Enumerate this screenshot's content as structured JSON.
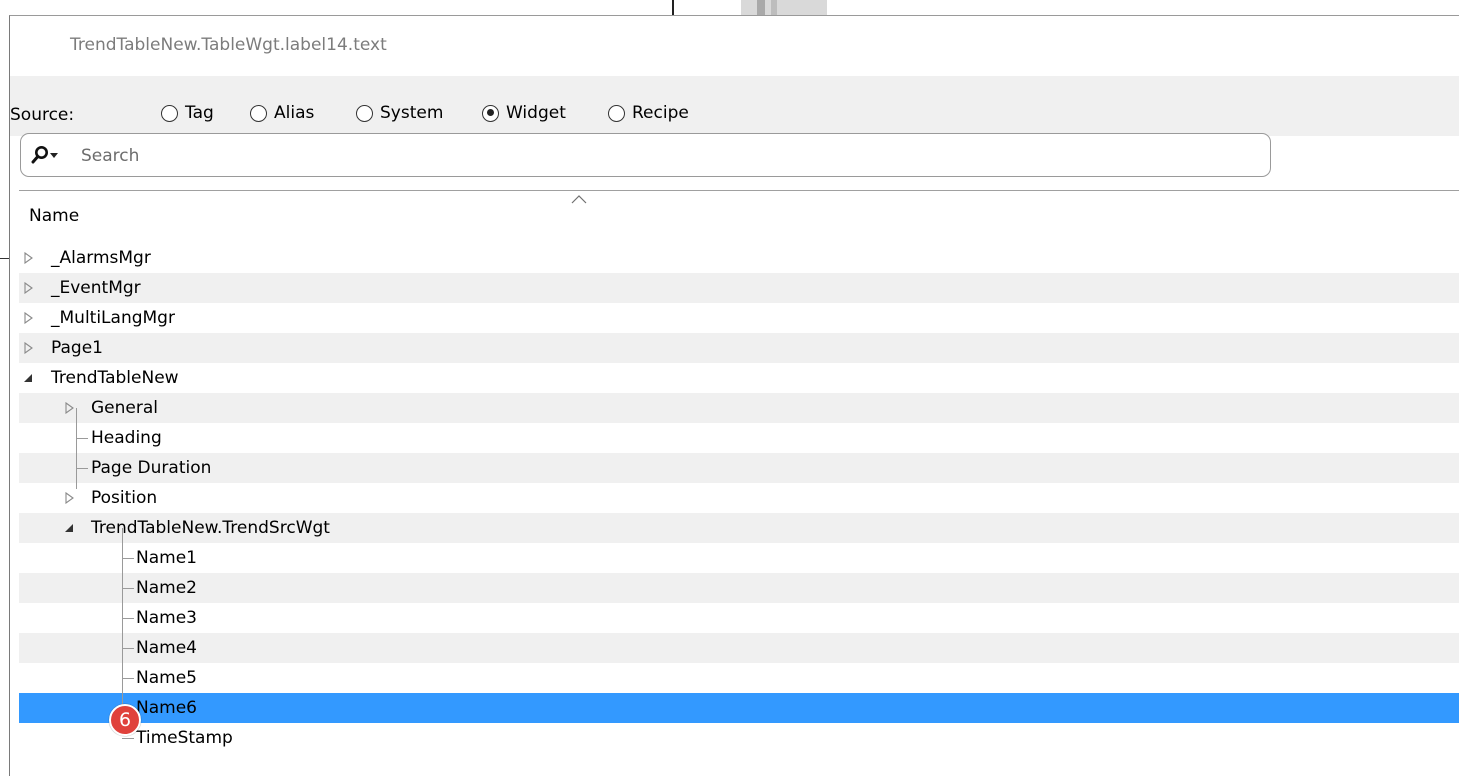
{
  "dialog": {
    "title": "TrendTableNew.TableWgt.label14.text",
    "source_label": "Source:",
    "source_options": [
      {
        "label": "Tag",
        "checked": false
      },
      {
        "label": "Alias",
        "checked": false
      },
      {
        "label": "System",
        "checked": false
      },
      {
        "label": "Widget",
        "checked": true
      },
      {
        "label": "Recipe",
        "checked": false
      }
    ],
    "search": {
      "placeholder": "Search",
      "value": "",
      "icon": "search-icon"
    },
    "tree": {
      "header": "Name",
      "items": [
        {
          "label": "_AlarmsMgr",
          "level": 0,
          "expander": "collapsed"
        },
        {
          "label": "_EventMgr",
          "level": 0,
          "expander": "collapsed"
        },
        {
          "label": "_MultiLangMgr",
          "level": 0,
          "expander": "collapsed"
        },
        {
          "label": "Page1",
          "level": 0,
          "expander": "collapsed"
        },
        {
          "label": "TrendTableNew",
          "level": 0,
          "expander": "expanded"
        },
        {
          "label": "General",
          "level": 1,
          "expander": "collapsed"
        },
        {
          "label": "Heading",
          "level": 1,
          "expander": "none"
        },
        {
          "label": "Page Duration",
          "level": 1,
          "expander": "none"
        },
        {
          "label": "Position",
          "level": 1,
          "expander": "collapsed"
        },
        {
          "label": "TrendTableNew.TrendSrcWgt",
          "level": 1,
          "expander": "expanded"
        },
        {
          "label": "Name1",
          "level": 2,
          "expander": "none"
        },
        {
          "label": "Name2",
          "level": 2,
          "expander": "none"
        },
        {
          "label": "Name3",
          "level": 2,
          "expander": "none"
        },
        {
          "label": "Name4",
          "level": 2,
          "expander": "none"
        },
        {
          "label": "Name5",
          "level": 2,
          "expander": "none"
        },
        {
          "label": "Name6",
          "level": 2,
          "expander": "none",
          "selected": true
        },
        {
          "label": "TimeStamp",
          "level": 2,
          "expander": "none"
        }
      ]
    },
    "callout_badge": "6"
  },
  "colors": {
    "selection": "#3399ff",
    "badge": "#e0413b",
    "alt_row": "#f0f0f0",
    "toolbar": "#f0f0f0"
  }
}
